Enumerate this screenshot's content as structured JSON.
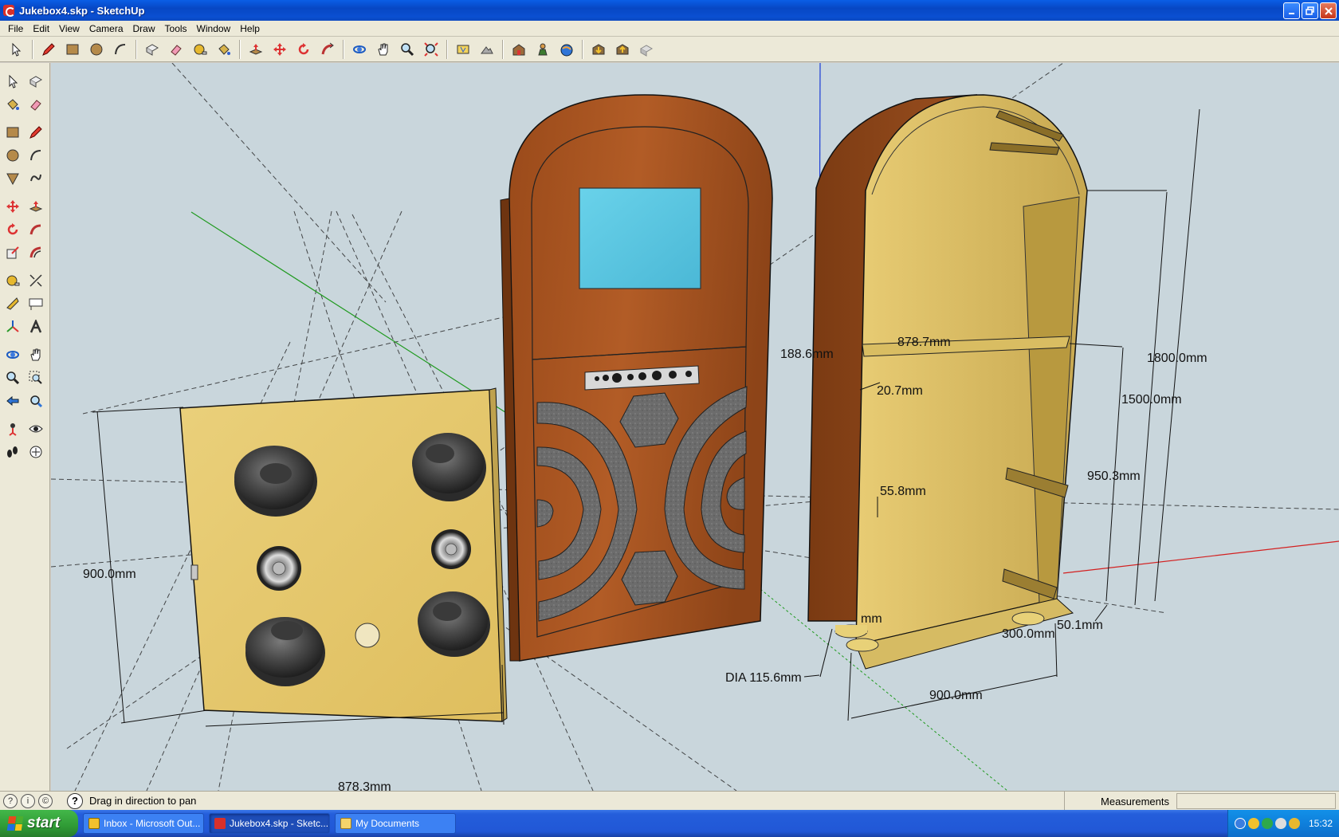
{
  "window": {
    "title": "Jukebox4.skp - SketchUp",
    "controls": [
      "minimize-icon",
      "restore-icon",
      "close-icon"
    ]
  },
  "menu": [
    "File",
    "Edit",
    "View",
    "Camera",
    "Draw",
    "Tools",
    "Window",
    "Help"
  ],
  "toolbar": {
    "top_tools": [
      "select",
      "pencil",
      "rectangle",
      "circle",
      "arc",
      "make-component",
      "eraser",
      "tape-measure",
      "paint-bucket",
      "push-pull",
      "move",
      "rotate",
      "follow-me",
      "orbit",
      "pan",
      "zoom",
      "zoom-extents",
      "previous-view",
      "next-view",
      "add-location",
      "toggle-terrain",
      "get-models",
      "share-model",
      "share-component",
      "get-photo-texture"
    ],
    "left_tools": [
      "select",
      "make-component",
      "paint-bucket",
      "eraser",
      "rectangle",
      "line",
      "circle",
      "arc",
      "polygon",
      "freehand",
      "move",
      "push-pull",
      "rotate",
      "follow-me",
      "scale",
      "offset",
      "tape-measure",
      "dimension",
      "protractor",
      "text",
      "axes",
      "3d-text",
      "orbit",
      "pan",
      "zoom",
      "zoom-window",
      "previous",
      "zoom-extents",
      "position-camera",
      "look-around",
      "walk",
      "section-plane"
    ]
  },
  "viewport": {
    "dimensions": {
      "d_900_left": "900.0mm",
      "d_878_bottom": "878.3mm",
      "d_188": "188.6mm",
      "d_878_shelf": "878.7mm",
      "d_20": "20.7mm",
      "d_55": "55.8mm",
      "d_1800": "1800.0mm",
      "d_1500": "1500.0mm",
      "d_950": "950.3mm",
      "d_300": "300.0mm",
      "d_50": "50.1mm",
      "d_dia": "DIA 115.6mm",
      "d_900_bottom": "900.0mm",
      "d_mm_partial": "mm"
    }
  },
  "status": {
    "hint": "Drag in direction to pan",
    "measurements_label": "Measurements",
    "measurements_value": ""
  },
  "taskbar": {
    "start": "start",
    "tasks": [
      "Inbox - Microsoft Out...",
      "Jukebox4.skp - Sketc...",
      "My Documents"
    ],
    "clock": "15:32"
  },
  "colors": {
    "wood": "#a3511f",
    "screen": "#5bc6e0",
    "panel": "#e6c66a",
    "felt": "#6e6e6e",
    "sky": "#c9d6dc"
  }
}
